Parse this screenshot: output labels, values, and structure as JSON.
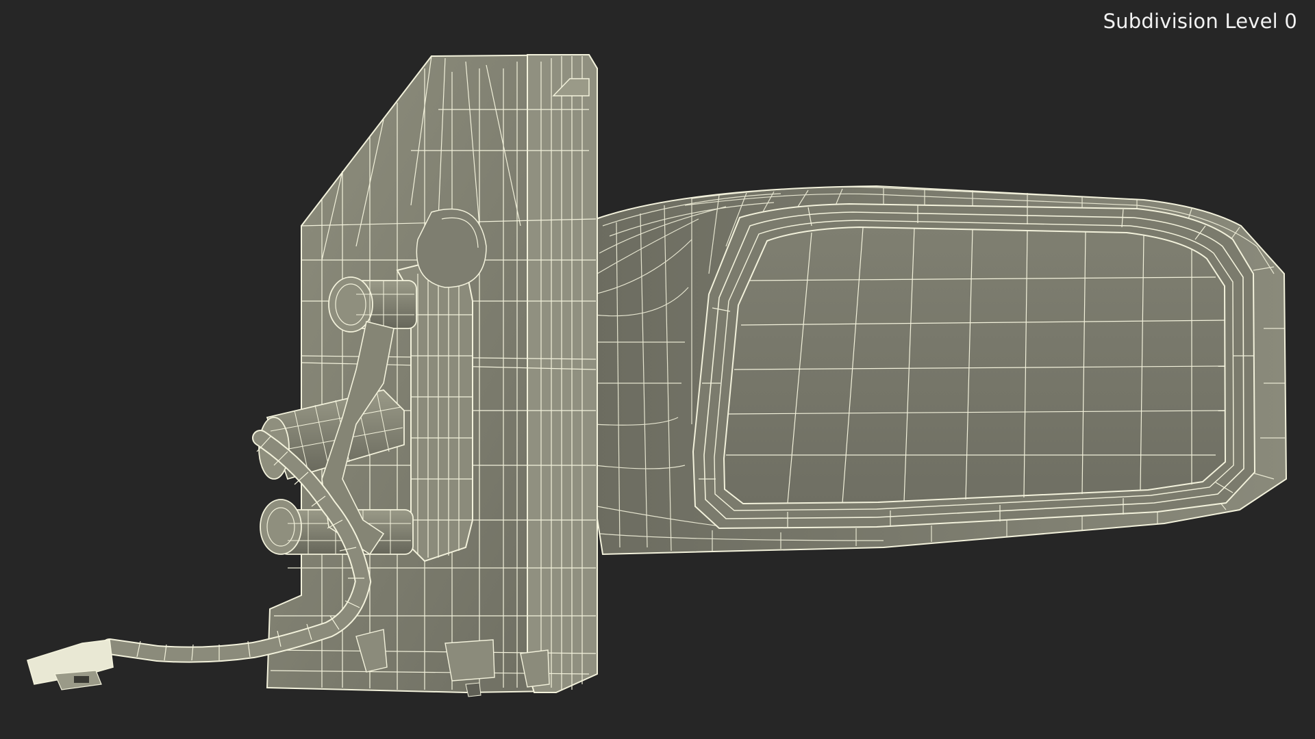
{
  "viewport": {
    "overlay_label": "Subdivision Level 0",
    "background_color": "#262626",
    "model_fill": "#8a8a7c",
    "model_fill_dark": "#6f6f62",
    "wire_color": "#f3f2dc"
  }
}
